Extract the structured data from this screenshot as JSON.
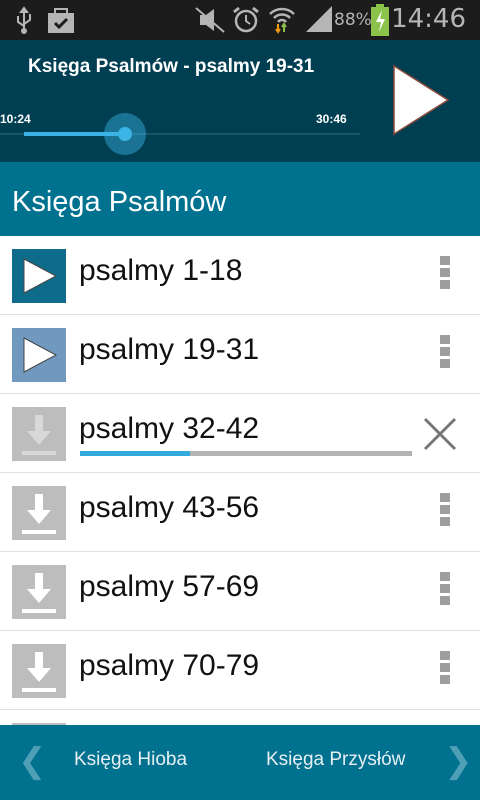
{
  "status_bar": {
    "time": "14:46",
    "battery_percent": "88%",
    "icons": [
      "usb-icon",
      "shopping-bag-check-icon",
      "mute-icon",
      "alarm-icon",
      "wifi-icon",
      "signal-icon",
      "battery-charging-icon"
    ]
  },
  "player": {
    "title": "Księga Psalmów - psalmy 19-31",
    "current_time": "10:24",
    "total_time": "30:46",
    "progress": 0.3,
    "play_icon": "play-icon"
  },
  "header": {
    "title": "Księga Psalmów"
  },
  "items": [
    {
      "label": "psalmy 1-18",
      "state": "playable",
      "icon_color": "#0e6c8a"
    },
    {
      "label": "psalmy 19-31",
      "state": "playable",
      "icon_color": "#7199c0"
    },
    {
      "label": "psalmy 32-42",
      "state": "downloading",
      "download_progress": 0.33
    },
    {
      "label": "psalmy 43-56",
      "state": "download"
    },
    {
      "label": "psalmy 57-69",
      "state": "download"
    },
    {
      "label": "psalmy 70-79",
      "state": "download"
    }
  ],
  "bottom_nav": {
    "prev": "Księga Hioba",
    "next": "Księga Przysłów"
  },
  "colors": {
    "player_bg": "#003f52",
    "accent": "#00718f",
    "progress": "#3bb4e5"
  }
}
